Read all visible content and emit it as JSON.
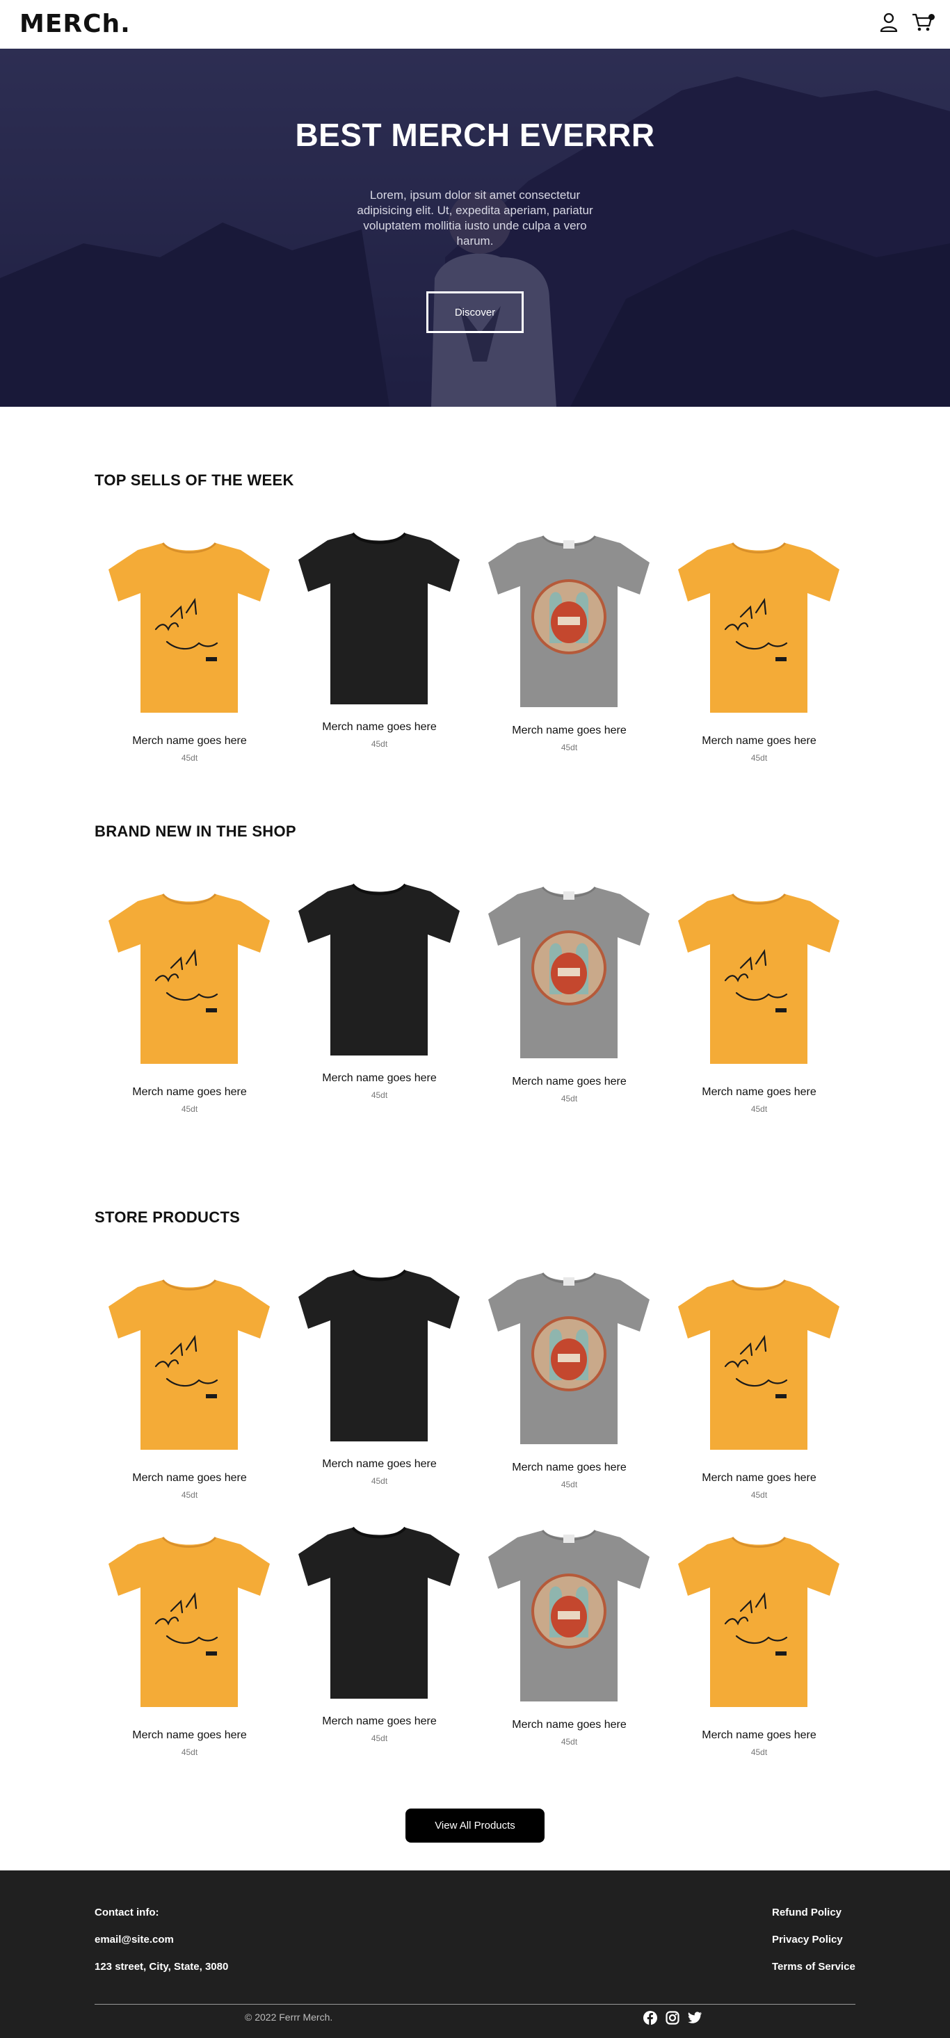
{
  "header": {
    "logo": "MERCh."
  },
  "hero": {
    "title": "BEST MERCH EVERRR",
    "text": "Lorem, ipsum dolor sit amet consectetur adipisicing elit. Ut, expedita aperiam, pariatur voluptatem mollitia iusto unde culpa a vero harum.",
    "button": "Discover"
  },
  "sections": [
    {
      "title": "TOP SELLS OF THE WEEK",
      "products": [
        {
          "name": "Merch name goes here",
          "price": "45dt",
          "shirt": "yellow-rhino-shirt"
        },
        {
          "name": "Merch name goes here",
          "price": "45dt",
          "shirt": "black-plain-shirt"
        },
        {
          "name": "Merch name goes here",
          "price": "45dt",
          "shirt": "grey-hmb-shirt"
        },
        {
          "name": "Merch name goes here",
          "price": "45dt",
          "shirt": "yellow-rhino-shirt"
        }
      ]
    },
    {
      "title": "BRAND NEW IN THE SHOP",
      "products": [
        {
          "name": "Merch name goes here",
          "price": "45dt",
          "shirt": "yellow-rhino-shirt"
        },
        {
          "name": "Merch name goes here",
          "price": "45dt",
          "shirt": "black-plain-shirt"
        },
        {
          "name": "Merch name goes here",
          "price": "45dt",
          "shirt": "grey-hmb-shirt"
        },
        {
          "name": "Merch name goes here",
          "price": "45dt",
          "shirt": "yellow-rhino-shirt"
        }
      ]
    },
    {
      "title": "STORE PRODUCTS",
      "rows": [
        [
          {
            "name": "Merch name goes here",
            "price": "45dt",
            "shirt": "yellow-rhino-shirt"
          },
          {
            "name": "Merch name goes here",
            "price": "45dt",
            "shirt": "black-plain-shirt"
          },
          {
            "name": "Merch name goes here",
            "price": "45dt",
            "shirt": "grey-hmb-shirt"
          },
          {
            "name": "Merch name goes here",
            "price": "45dt",
            "shirt": "yellow-rhino-shirt"
          }
        ],
        [
          {
            "name": "Merch name goes here",
            "price": "45dt",
            "shirt": "yellow-rhino-shirt"
          },
          {
            "name": "Merch name goes here",
            "price": "45dt",
            "shirt": "black-plain-shirt"
          },
          {
            "name": "Merch name goes here",
            "price": "45dt",
            "shirt": "grey-hmb-shirt"
          },
          {
            "name": "Merch name goes here",
            "price": "45dt",
            "shirt": "yellow-rhino-shirt"
          }
        ]
      ]
    }
  ],
  "view_all_button": "View All Products",
  "footer": {
    "contact_label": "Contact info:",
    "email": "email@site.com",
    "address": "123 street, City, State, 3080",
    "links": [
      "Refund Policy",
      "Privacy Policy",
      "Terms of Service"
    ],
    "copyright": "© 2022 Ferrr Merch.",
    "social": [
      "facebook-icon",
      "instagram-icon",
      "twitter-icon"
    ]
  },
  "colors": {
    "hero_overlay": "#16163e",
    "shirt_yellow": "#f4ab37",
    "shirt_black": "#1f1f1f",
    "shirt_grey": "#8f8f8f",
    "footer_bg": "#202020",
    "button_bg": "#000000"
  }
}
